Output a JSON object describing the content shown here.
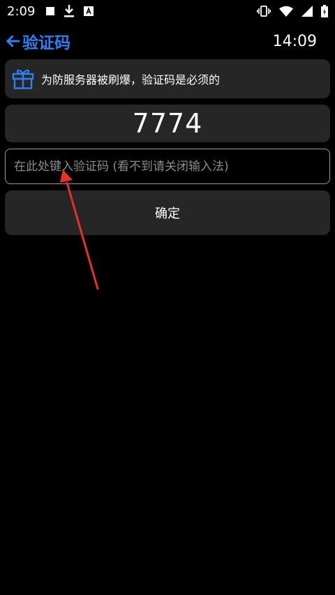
{
  "status_bar": {
    "time": "2:09",
    "left_icons": [
      "stop-icon",
      "download-icon",
      "text-notification-icon"
    ],
    "right_icons": [
      "vibrate-icon",
      "wifi-icon",
      "signal-icon",
      "battery-icon"
    ]
  },
  "header": {
    "back_icon": "arrow-left-icon",
    "title": "验证码",
    "clock": "14:09"
  },
  "notice": {
    "icon": "gift-icon",
    "text": "为防服务器被刷爆，验证码是必须的"
  },
  "captcha": {
    "code": "7774"
  },
  "input": {
    "value": "",
    "placeholder": "在此处键入验证码 (看不到请关闭输入法)"
  },
  "confirm": {
    "label": "确定"
  },
  "colors": {
    "background": "#000000",
    "card": "#262626",
    "accent": "#2f7ff2",
    "annotation": "#e8302a",
    "input_border": "#9a9a9a"
  }
}
